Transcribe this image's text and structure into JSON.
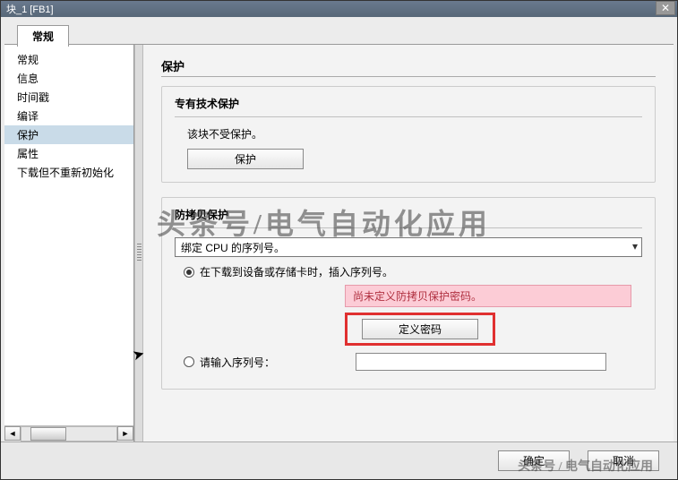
{
  "window": {
    "title": "块_1 [FB1]"
  },
  "tabs": {
    "general": "常规"
  },
  "sidebar": {
    "items": [
      {
        "label": "常规"
      },
      {
        "label": "信息"
      },
      {
        "label": "时间戳"
      },
      {
        "label": "编译"
      },
      {
        "label": "保护",
        "selected": true
      },
      {
        "label": "属性"
      },
      {
        "label": "下载但不重新初始化"
      }
    ]
  },
  "content": {
    "heading": "保护",
    "tech_protect": {
      "title": "专有技术保护",
      "status": "该块不受保护。",
      "button": "保护"
    },
    "copy_protect": {
      "title": "防拷贝保护",
      "dropdown_value": "绑定 CPU 的序列号。",
      "radio_download": "在下载到设备或存储卡时，插入序列号。",
      "warning": "尚未定义防拷贝保护密码。",
      "define_pw_button": "定义密码",
      "radio_serial": "请输入序列号："
    }
  },
  "footer": {
    "ok": "确定",
    "cancel": "取消"
  },
  "watermark": {
    "big": "头条号/电气自动化应用",
    "small": "头条号 / 电气自动化应用"
  }
}
